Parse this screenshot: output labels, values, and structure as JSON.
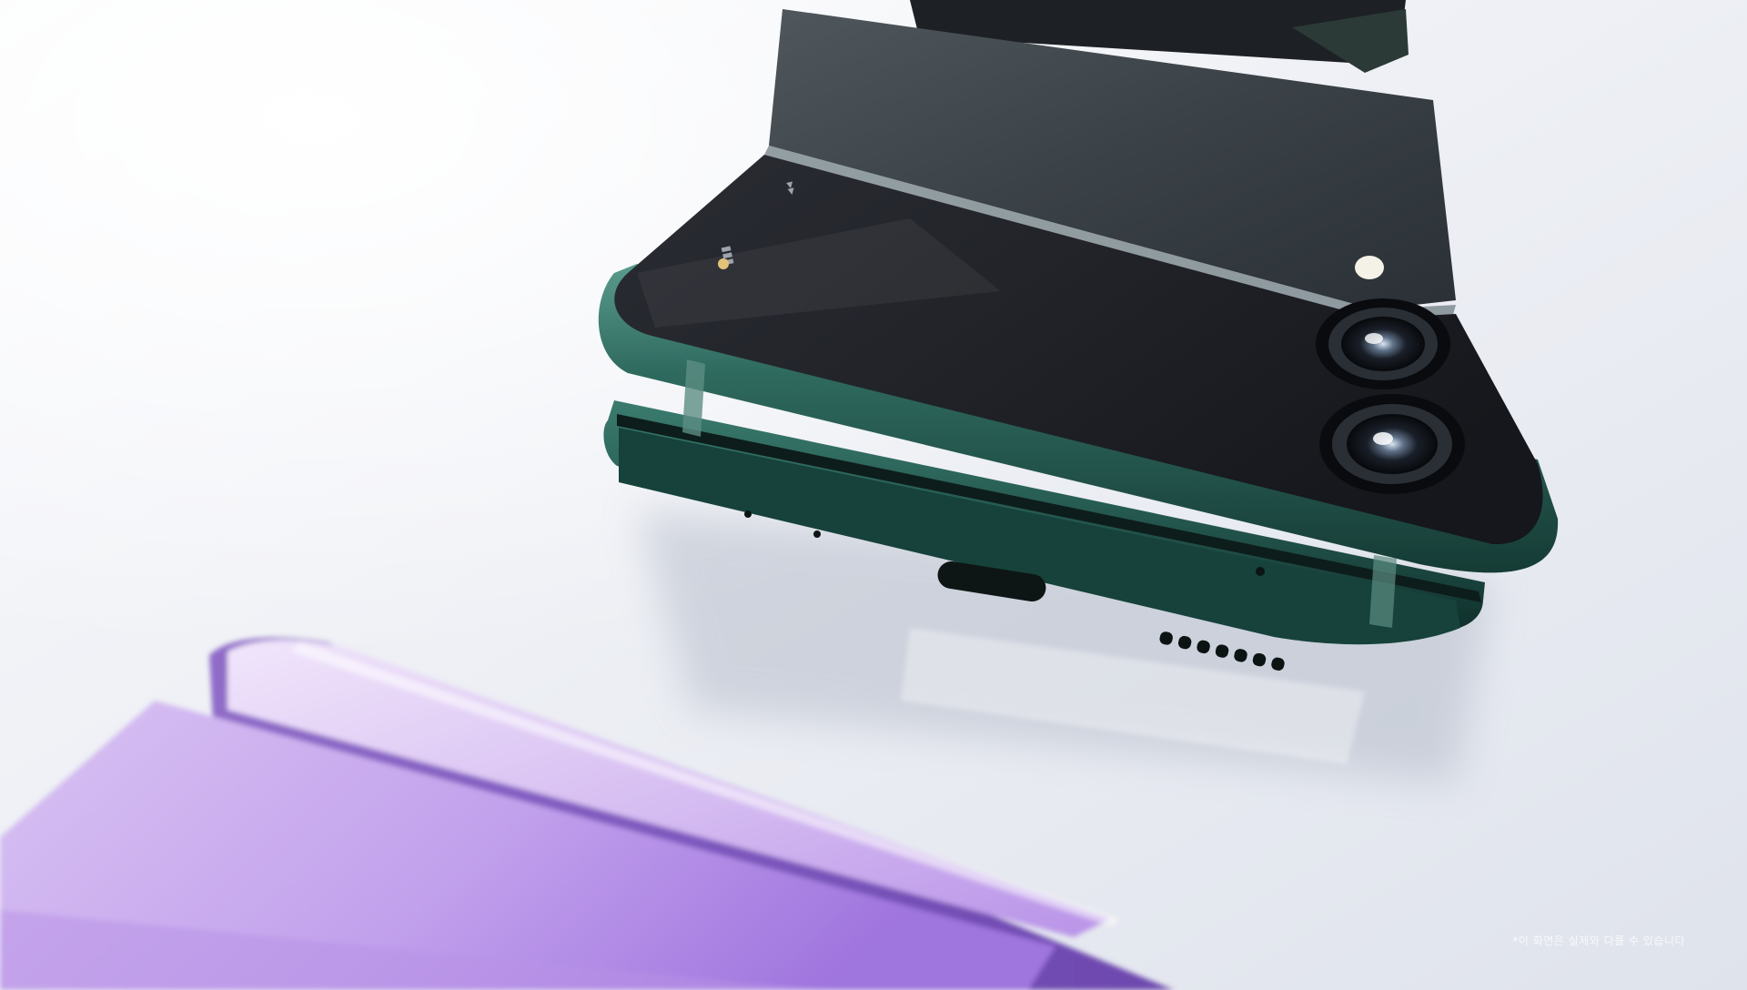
{
  "caption": {
    "text": "*이 화면은 실제와 다를 수 있습니다"
  },
  "colors": {
    "background": "#eceef4",
    "phone_green": "#1f4a43",
    "phone_green_rim": "#3f7b71",
    "phone_glass": "#1a1d23",
    "phone_lavender": "#c7a5ef"
  },
  "icons": [
    "camera-lens-icon",
    "flash-icon",
    "usb-c-port-icon",
    "speaker-grille-icon"
  ]
}
